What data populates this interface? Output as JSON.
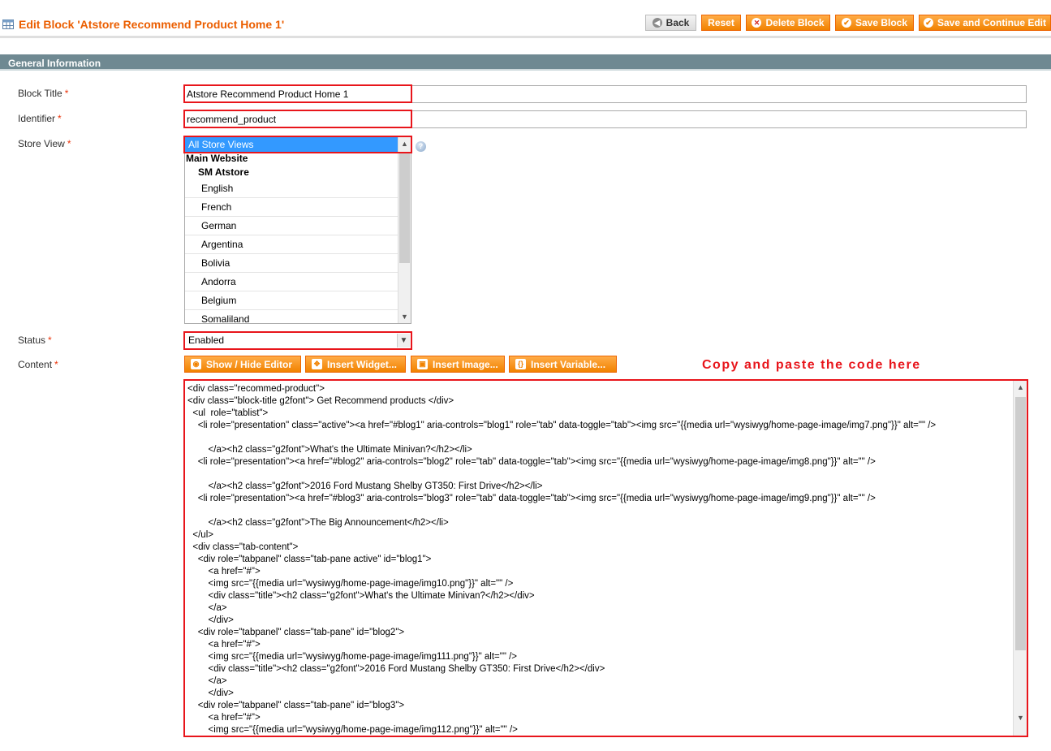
{
  "header": {
    "title": "Edit Block 'Atstore Recommend Product Home 1'",
    "buttons": {
      "back": "Back",
      "reset": "Reset",
      "delete": "Delete Block",
      "save": "Save Block",
      "save_continue": "Save and Continue Edit"
    }
  },
  "section": {
    "title": "General Information"
  },
  "form": {
    "block_title": {
      "label": "Block Title",
      "required": "*",
      "value": "Atstore Recommend Product Home 1"
    },
    "identifier": {
      "label": "Identifier",
      "required": "*",
      "value": "recommend_product"
    },
    "store_view": {
      "label": "Store View",
      "required": "*",
      "selected": "All Store Views",
      "website": "Main Website",
      "store": "SM Atstore",
      "options": [
        "English",
        "French",
        "German",
        "Argentina",
        "Bolivia",
        "Andorra",
        "Belgium",
        "Somaliland"
      ]
    },
    "status": {
      "label": "Status",
      "required": "*",
      "value": "Enabled"
    },
    "content": {
      "label": "Content",
      "required": "*",
      "toolbar": {
        "show_hide": "Show / Hide Editor",
        "insert_widget": "Insert Widget...",
        "insert_image": "Insert Image...",
        "insert_variable": "Insert Variable..."
      },
      "annotation": "Copy and paste the code here",
      "code_lines": [
        "<div class=\"recommed-product\">",
        "<div class=\"block-title g2font\"> Get Recommend products </div>",
        "  <ul  role=\"tablist\">",
        "    <li role=\"presentation\" class=\"active\"><a href=\"#blog1\" aria-controls=\"blog1\" role=\"tab\" data-toggle=\"tab\"><img src=\"{{media url=\"wysiwyg/home-page-image/img7.png\"}}\" alt=\"\" />",
        "",
        "        </a><h2 class=\"g2font\">What's the Ultimate Minivan?</h2></li>",
        "    <li role=\"presentation\"><a href=\"#blog2\" aria-controls=\"blog2\" role=\"tab\" data-toggle=\"tab\"><img src=\"{{media url=\"wysiwyg/home-page-image/img8.png\"}}\" alt=\"\" />",
        "",
        "        </a><h2 class=\"g2font\">2016 Ford Mustang Shelby GT350: First Drive</h2></li>",
        "    <li role=\"presentation\"><a href=\"#blog3\" aria-controls=\"blog3\" role=\"tab\" data-toggle=\"tab\"><img src=\"{{media url=\"wysiwyg/home-page-image/img9.png\"}}\" alt=\"\" />",
        "",
        "        </a><h2 class=\"g2font\">The Big Announcement</h2></li>",
        "  </ul>",
        "  <div class=\"tab-content\">",
        "    <div role=\"tabpanel\" class=\"tab-pane active\" id=\"blog1\">",
        "        <a href=\"#\">",
        "        <img src=\"{{media url=\"wysiwyg/home-page-image/img10.png\"}}\" alt=\"\" />",
        "        <div class=\"title\"><h2 class=\"g2font\">What's the Ultimate Minivan?</h2></div>",
        "        </a>",
        "        </div>",
        "    <div role=\"tabpanel\" class=\"tab-pane\" id=\"blog2\">",
        "        <a href=\"#\">",
        "        <img src=\"{{media url=\"wysiwyg/home-page-image/img111.png\"}}\" alt=\"\" />",
        "        <div class=\"title\"><h2 class=\"g2font\">2016 Ford Mustang Shelby GT350: First Drive</h2></div>",
        "        </a>",
        "        </div>",
        "    <div role=\"tabpanel\" class=\"tab-pane\" id=\"blog3\">",
        "        <a href=\"#\">",
        "        <img src=\"{{media url=\"wysiwyg/home-page-image/img112.png\"}}\" alt=\"\" />"
      ]
    }
  },
  "colors": {
    "accent_orange": "#eb5e00",
    "button_orange": "#f18200",
    "section_bar": "#6f8992",
    "highlight_red": "#e8151b"
  }
}
